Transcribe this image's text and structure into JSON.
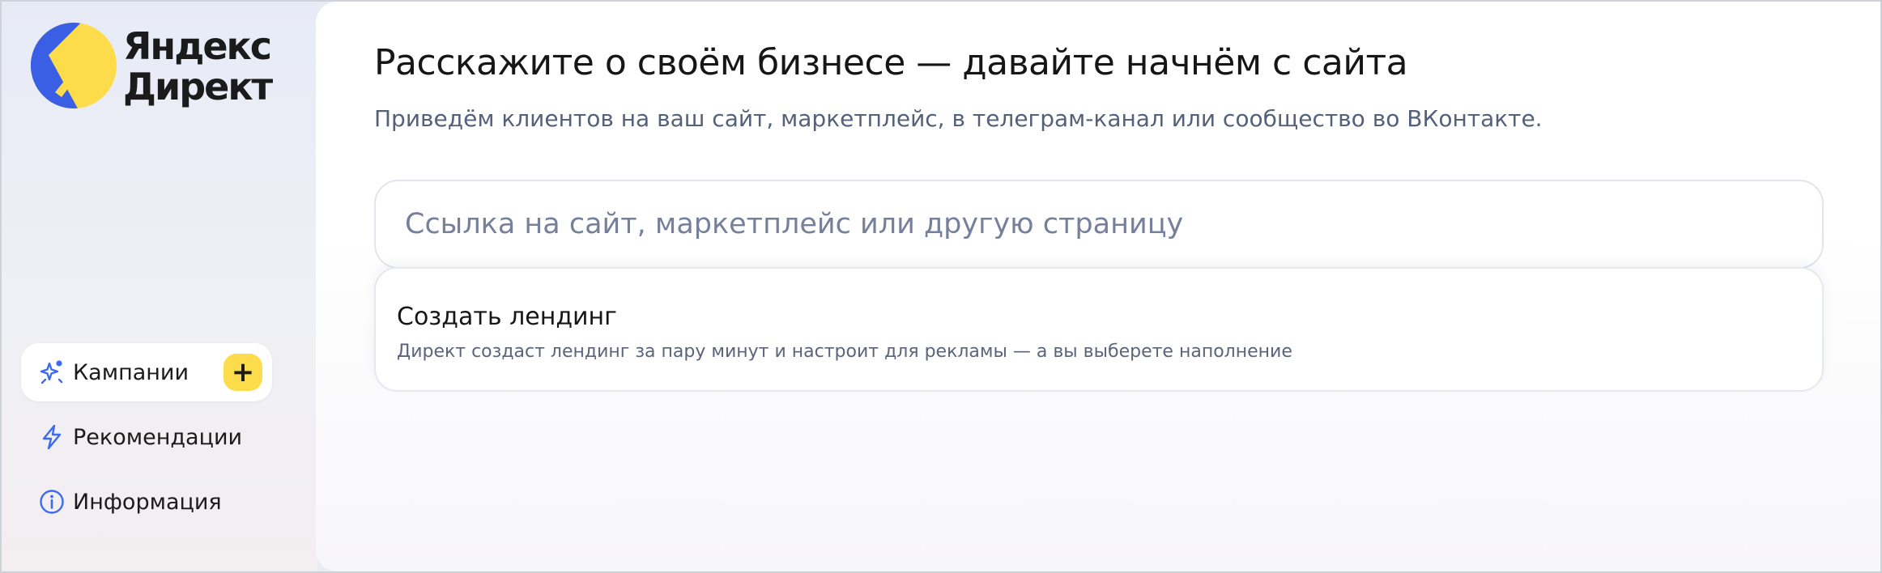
{
  "app": {
    "logo_line1": "Яндекс",
    "logo_line2": "Директ",
    "brand_yellow": "#fddc4c",
    "brand_blue": "#3a5fe5"
  },
  "sidebar": {
    "items": [
      {
        "label": "Кампании",
        "icon": "sparkle-stars-icon",
        "active": true,
        "action": "+"
      },
      {
        "label": "Рекомендации",
        "icon": "lightning-icon",
        "active": false
      },
      {
        "label": "Информация",
        "icon": "info-circle-icon",
        "active": false
      }
    ]
  },
  "main": {
    "title": "Расскажите о своём бизнесе — давайте начнём с сайта",
    "subtitle": "Приведём клиентов на ваш сайт, маркетплейс, в телеграм-канал или сообщество во ВКонтакте.",
    "url_input": {
      "value": "",
      "placeholder": "Ссылка на сайт, маркетплейс или другую страницу"
    },
    "landing_option": {
      "title": "Создать лендинг",
      "description": "Директ создаст лендинг за пару минут и настроит для рекламы — а вы выберете наполнение"
    }
  }
}
